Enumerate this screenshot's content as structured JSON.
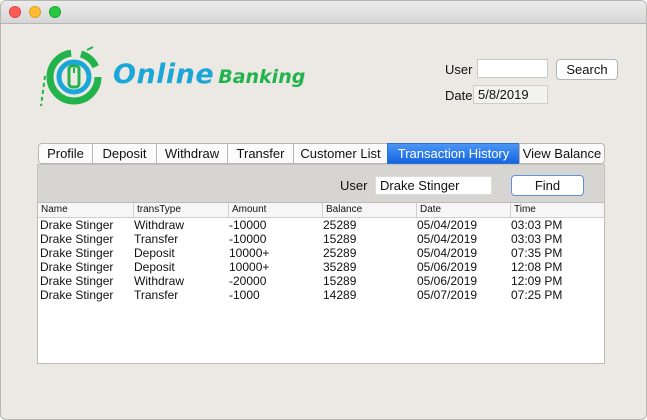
{
  "window": {
    "title": ""
  },
  "brand": {
    "main": "Online",
    "sub": "Banking"
  },
  "header": {
    "user_label": "User",
    "user_value": "",
    "search_label": "Search",
    "date_label": "Date",
    "date_value": "5/8/2019"
  },
  "tabs": [
    {
      "label": "Profile"
    },
    {
      "label": "Deposit"
    },
    {
      "label": "Withdraw"
    },
    {
      "label": "Transfer"
    },
    {
      "label": "Customer List"
    },
    {
      "label": "Transaction History",
      "active": true
    },
    {
      "label": "View Balance"
    }
  ],
  "filter": {
    "user_label": "User",
    "user_value": "Drake Stinger",
    "find_label": "Find"
  },
  "table": {
    "columns": [
      "Name",
      "transType",
      "Amount",
      "Balance",
      "Date",
      "Time"
    ],
    "rows": [
      [
        "Drake Stinger",
        "Withdraw",
        "-10000",
        "25289",
        "05/04/2019",
        "03:03 PM"
      ],
      [
        "Drake Stinger",
        "Transfer",
        "-10000",
        "15289",
        "05/04/2019",
        "03:03 PM"
      ],
      [
        "Drake Stinger",
        "Deposit",
        "10000+",
        "25289",
        "05/04/2019",
        "07:35 PM"
      ],
      [
        "Drake Stinger",
        "Deposit",
        "10000+",
        "35289",
        "05/06/2019",
        "12:08 PM"
      ],
      [
        "Drake Stinger",
        "Withdraw",
        "-20000",
        "15289",
        "05/06/2019",
        "12:09 PM"
      ],
      [
        "Drake Stinger",
        "Transfer",
        "-1000",
        "14289",
        "05/07/2019",
        "07:25 PM"
      ]
    ]
  },
  "colors": {
    "accent": "#1665e0",
    "brand_blue": "#1aa7d8",
    "brand_green": "#22b34c"
  }
}
